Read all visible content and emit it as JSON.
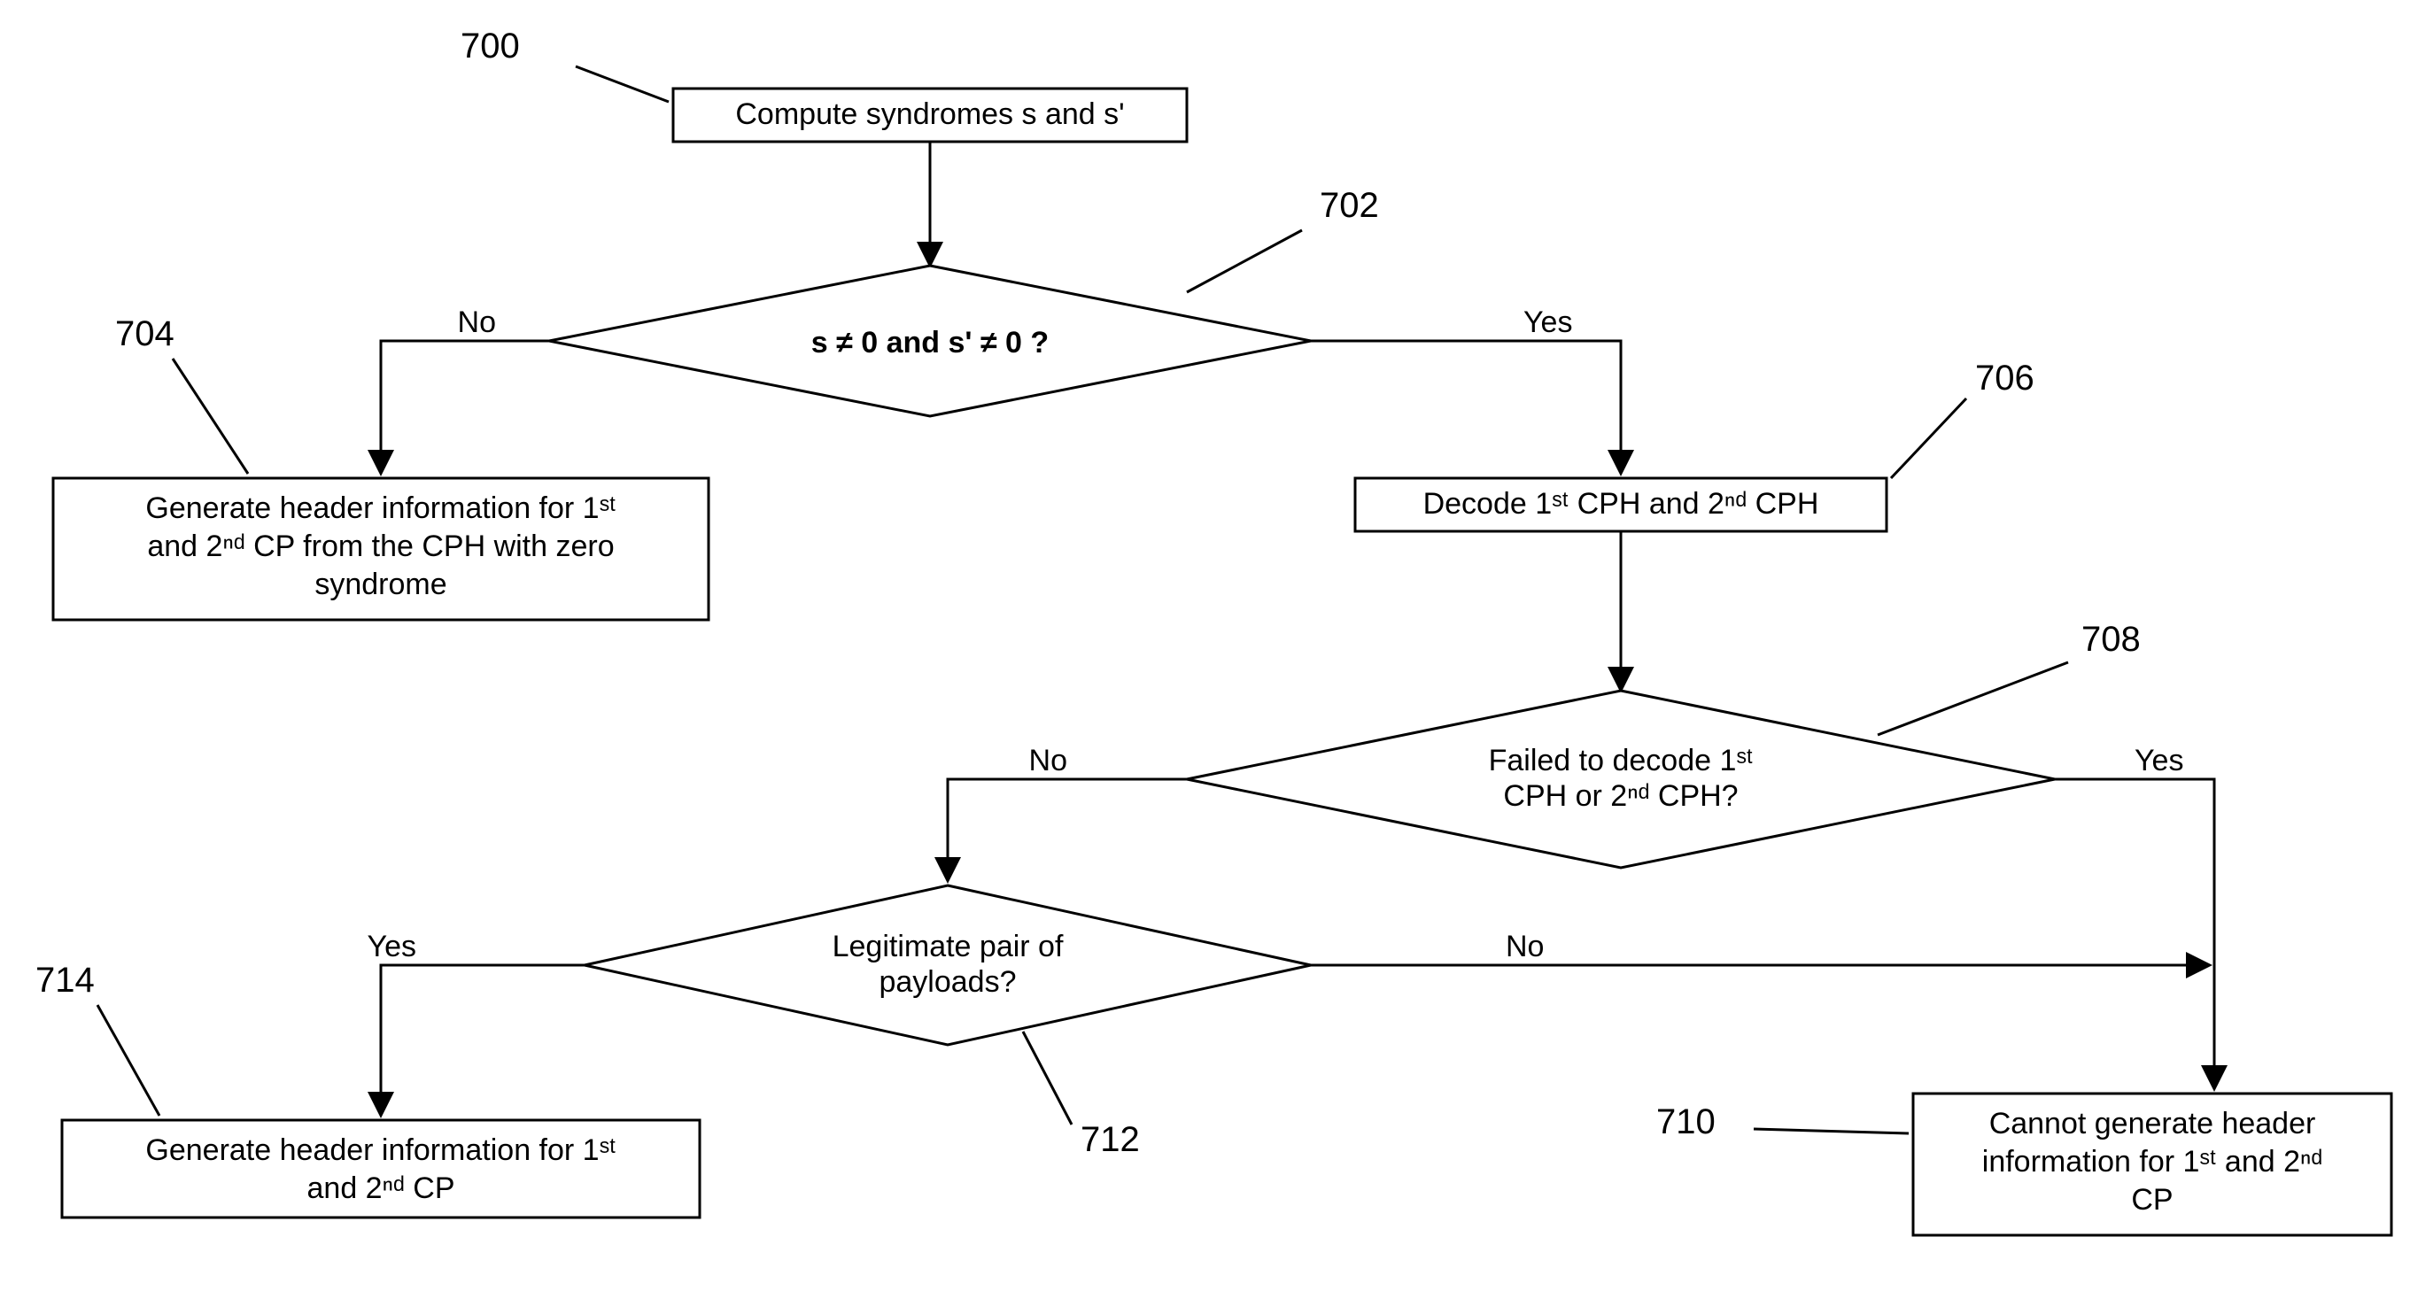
{
  "refs": {
    "r700": "700",
    "r702": "702",
    "r704": "704",
    "r706": "706",
    "r708": "708",
    "r710": "710",
    "r712": "712",
    "r714": "714"
  },
  "boxes": {
    "b700": "Compute syndromes s and s'",
    "b704_l1": "Generate header information for 1ˢᵗ",
    "b704_l2": "and 2ⁿᵈ CP from the CPH with zero",
    "b704_l3": "syndrome",
    "b706": "Decode 1ˢᵗ CPH and 2ⁿᵈ CPH",
    "b710_l1": "Cannot generate header",
    "b710_l2": "information for 1ˢᵗ and 2ⁿᵈ",
    "b710_l3": "CP",
    "b714_l1": "Generate header information for 1ˢᵗ",
    "b714_l2": "and 2ⁿᵈ CP"
  },
  "diamonds": {
    "d702": "s ≠ 0 and s' ≠ 0 ?",
    "d708_l1": "Failed to decode 1ˢᵗ",
    "d708_l2": "CPH or 2ⁿᵈ CPH?",
    "d712_l1": "Legitimate pair of",
    "d712_l2": "payloads?"
  },
  "labels": {
    "yes": "Yes",
    "no": "No"
  }
}
